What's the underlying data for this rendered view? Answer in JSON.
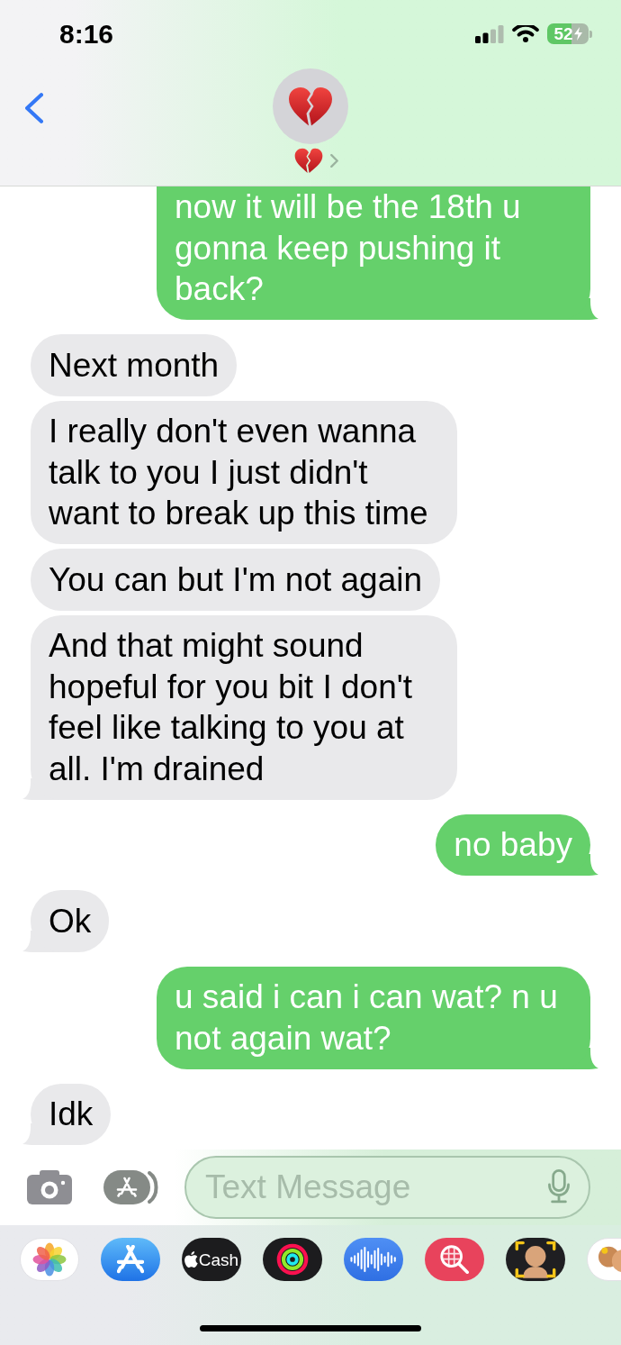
{
  "status_bar": {
    "time": "8:16",
    "battery": "52",
    "charging": true
  },
  "messages": [
    {
      "kind": "sent",
      "text": "now it will be the 18th u gonna keep pushing it back?",
      "cut_off": true,
      "tail": true
    },
    {
      "kind": "received",
      "text": "Next month",
      "cut_off": false,
      "tail": false
    },
    {
      "kind": "received",
      "text": "I really don't even wanna talk to you I just didn't want to break up this time",
      "cut_off": false,
      "tail": false
    },
    {
      "kind": "received",
      "text": "You can but I'm not again",
      "cut_off": false,
      "tail": false
    },
    {
      "kind": "received",
      "text": "And that might sound hopeful for you bit I don't feel like talking to you at all. I'm drained",
      "cut_off": false,
      "tail": true
    },
    {
      "kind": "sent",
      "text": "no baby",
      "cut_off": false,
      "tail": true
    },
    {
      "kind": "received",
      "text": "Ok",
      "cut_off": false,
      "tail": true
    },
    {
      "kind": "sent",
      "text": "u said i can i can wat? n u not again wat?",
      "cut_off": false,
      "tail": true
    },
    {
      "kind": "received",
      "text": "Idk",
      "cut_off": false,
      "tail": true
    }
  ],
  "composer": {
    "placeholder": "Text Message"
  },
  "app_drawer": [
    {
      "kind": "photos"
    },
    {
      "kind": "app_store"
    },
    {
      "kind": "cash",
      "label": "Cash"
    },
    {
      "kind": "activity"
    },
    {
      "kind": "audio"
    },
    {
      "kind": "search"
    },
    {
      "kind": "memoji"
    },
    {
      "kind": "stickers"
    }
  ]
}
